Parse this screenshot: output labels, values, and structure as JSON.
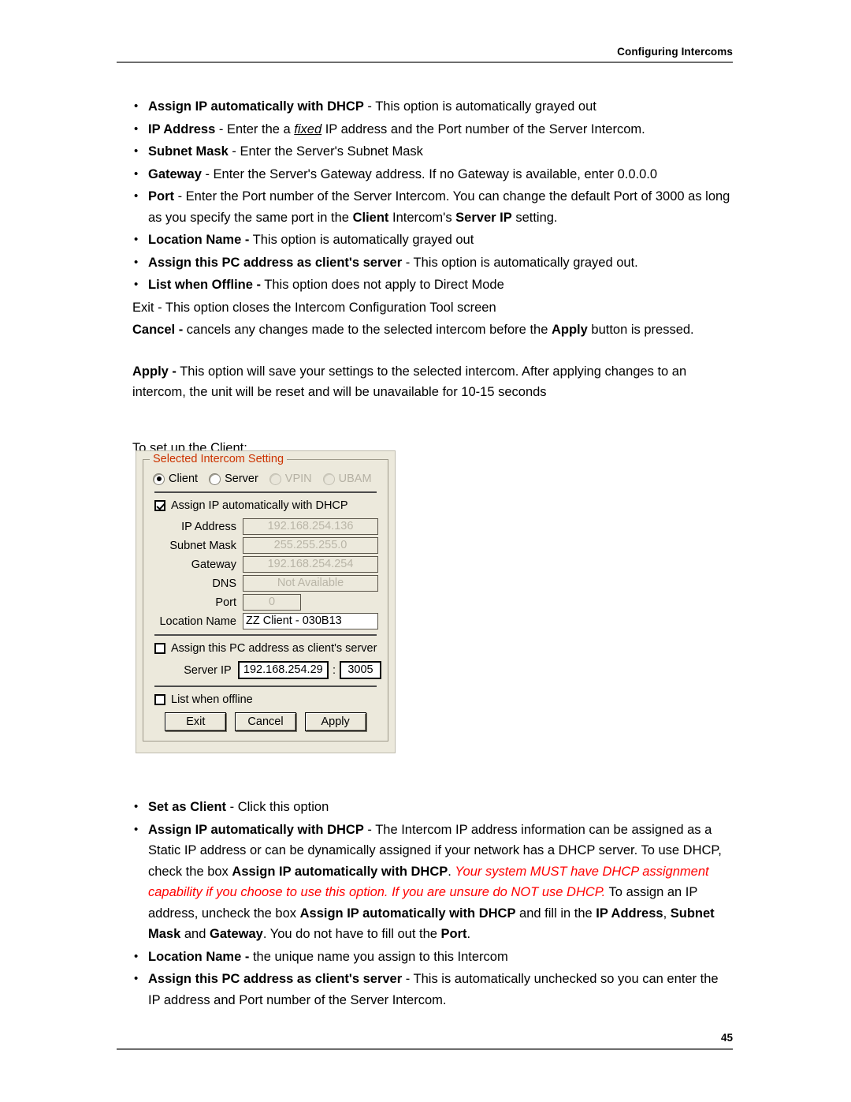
{
  "header": {
    "title": "Configuring Intercoms"
  },
  "footer": {
    "page_number": "45"
  },
  "body": {
    "bullets_top": [
      {
        "term": "Assign IP automatically with DHCP",
        "rest": " - This option is automatically grayed out"
      },
      {
        "term": "IP Address",
        "rest_pre": " - Enter the a ",
        "emph": "fixed",
        "rest_post": " IP address and the Port number of the Server Intercom."
      },
      {
        "term": "Subnet Mask",
        "rest": " - Enter the Server's Subnet Mask"
      },
      {
        "term": "Gateway",
        "rest": " - Enter the Server's Gateway address.  If no Gateway is available, enter 0.0.0.0"
      },
      {
        "term": "Port",
        "rest_pre": " - Enter the Port number of the Server Intercom. You can change the default Port of 3000 as long as you specify the same port in the ",
        "bold_a": "Client",
        "mid": " Intercom's ",
        "bold_b": "Server IP",
        "rest_post": " setting."
      },
      {
        "term": "Location Name -",
        "rest": " This option is automatically grayed out"
      },
      {
        "term": "Assign this PC address as client's server",
        "rest": " - This option is automatically grayed out."
      },
      {
        "term": "List when Offline -",
        "rest": " This option does not apply to Direct Mode"
      }
    ],
    "exit_para": "Exit - This option closes the Intercom Configuration Tool screen",
    "cancel_para": {
      "term": "Cancel -",
      "rest_pre": " cancels any changes made to the selected intercom before the ",
      "bold_a": "Apply",
      "rest_post": " button is pressed."
    },
    "apply_para": {
      "term": "Apply -",
      "rest": " This option will save your settings to the selected intercom.  After applying changes to an intercom, the unit will be reset and will be unavailable for 10-15 seconds"
    },
    "setup_line": "To set up the Client:",
    "bullets_bottom": [
      {
        "term": "Set as Client",
        "rest": " - Click this option"
      },
      {
        "term": "Assign IP automatically with DHCP",
        "seg1": " - The Intercom IP address information can be assigned as a Static IP address or can be dynamically assigned if your network has a DHCP server. To use DHCP, check the box ",
        "bold_a": "Assign IP automatically with DHCP",
        "seg2": ". ",
        "red": "Your system MUST have DHCP assignment capability if you choose to use this option. If you are unsure do NOT use DHCP.",
        "seg3": "  To assign an IP address, uncheck the box ",
        "bold_b": "Assign IP automatically with DHCP",
        "seg4": " and fill in the ",
        "bold_c": "IP Address",
        "seg5": ", ",
        "bold_d": "Subnet Mask",
        "seg6": " and ",
        "bold_e": "Gateway",
        "seg7": ".  You do not have to fill out the ",
        "bold_f": "Port",
        "seg8": "."
      },
      {
        "term": "Location Name -",
        "rest": " the unique name you assign to this Intercom"
      },
      {
        "term": "Assign this PC address as client's server",
        "rest": " - This is automatically unchecked so you can enter the IP address and Port number of the Server Intercom."
      }
    ],
    "bullet_glyph": "•"
  },
  "dialog": {
    "groupbox_title": "Selected Intercom Setting",
    "groupbox_title_color": "#cc3300",
    "background_color": "#ece9dc",
    "radios": [
      {
        "label": "Client",
        "checked": true,
        "disabled": false
      },
      {
        "label": "Server",
        "checked": false,
        "disabled": false
      },
      {
        "label": "VPIN",
        "checked": false,
        "disabled": true
      },
      {
        "label": "UBAM",
        "checked": false,
        "disabled": true
      }
    ],
    "dhcp_checkbox": {
      "label": "Assign IP automatically with  DHCP",
      "checked": true
    },
    "fields": [
      {
        "label": "IP Address",
        "value": "192.168.254.136",
        "enabled": false,
        "size": "wide"
      },
      {
        "label": "Subnet Mask",
        "value": "255.255.255.0",
        "enabled": false,
        "size": "wide"
      },
      {
        "label": "Gateway",
        "value": "192.168.254.254",
        "enabled": false,
        "size": "wide"
      },
      {
        "label": "DNS",
        "value": "Not Available",
        "enabled": false,
        "size": "wide"
      },
      {
        "label": "Port",
        "value": "0",
        "enabled": false,
        "size": "narrow"
      },
      {
        "label": "Location Name",
        "value": "ZZ Client - 030B13",
        "enabled": true,
        "size": "wide"
      }
    ],
    "pc_address_checkbox": {
      "label": "Assign this PC address as client's server",
      "checked": false
    },
    "server_ip": {
      "label": "Server IP",
      "address": "192.168.254.29",
      "separator": ":",
      "port": "3005"
    },
    "list_offline_checkbox": {
      "label": "List when offline",
      "checked": false
    },
    "buttons": [
      {
        "label": "Exit"
      },
      {
        "label": "Cancel"
      },
      {
        "label": "Apply"
      }
    ]
  }
}
